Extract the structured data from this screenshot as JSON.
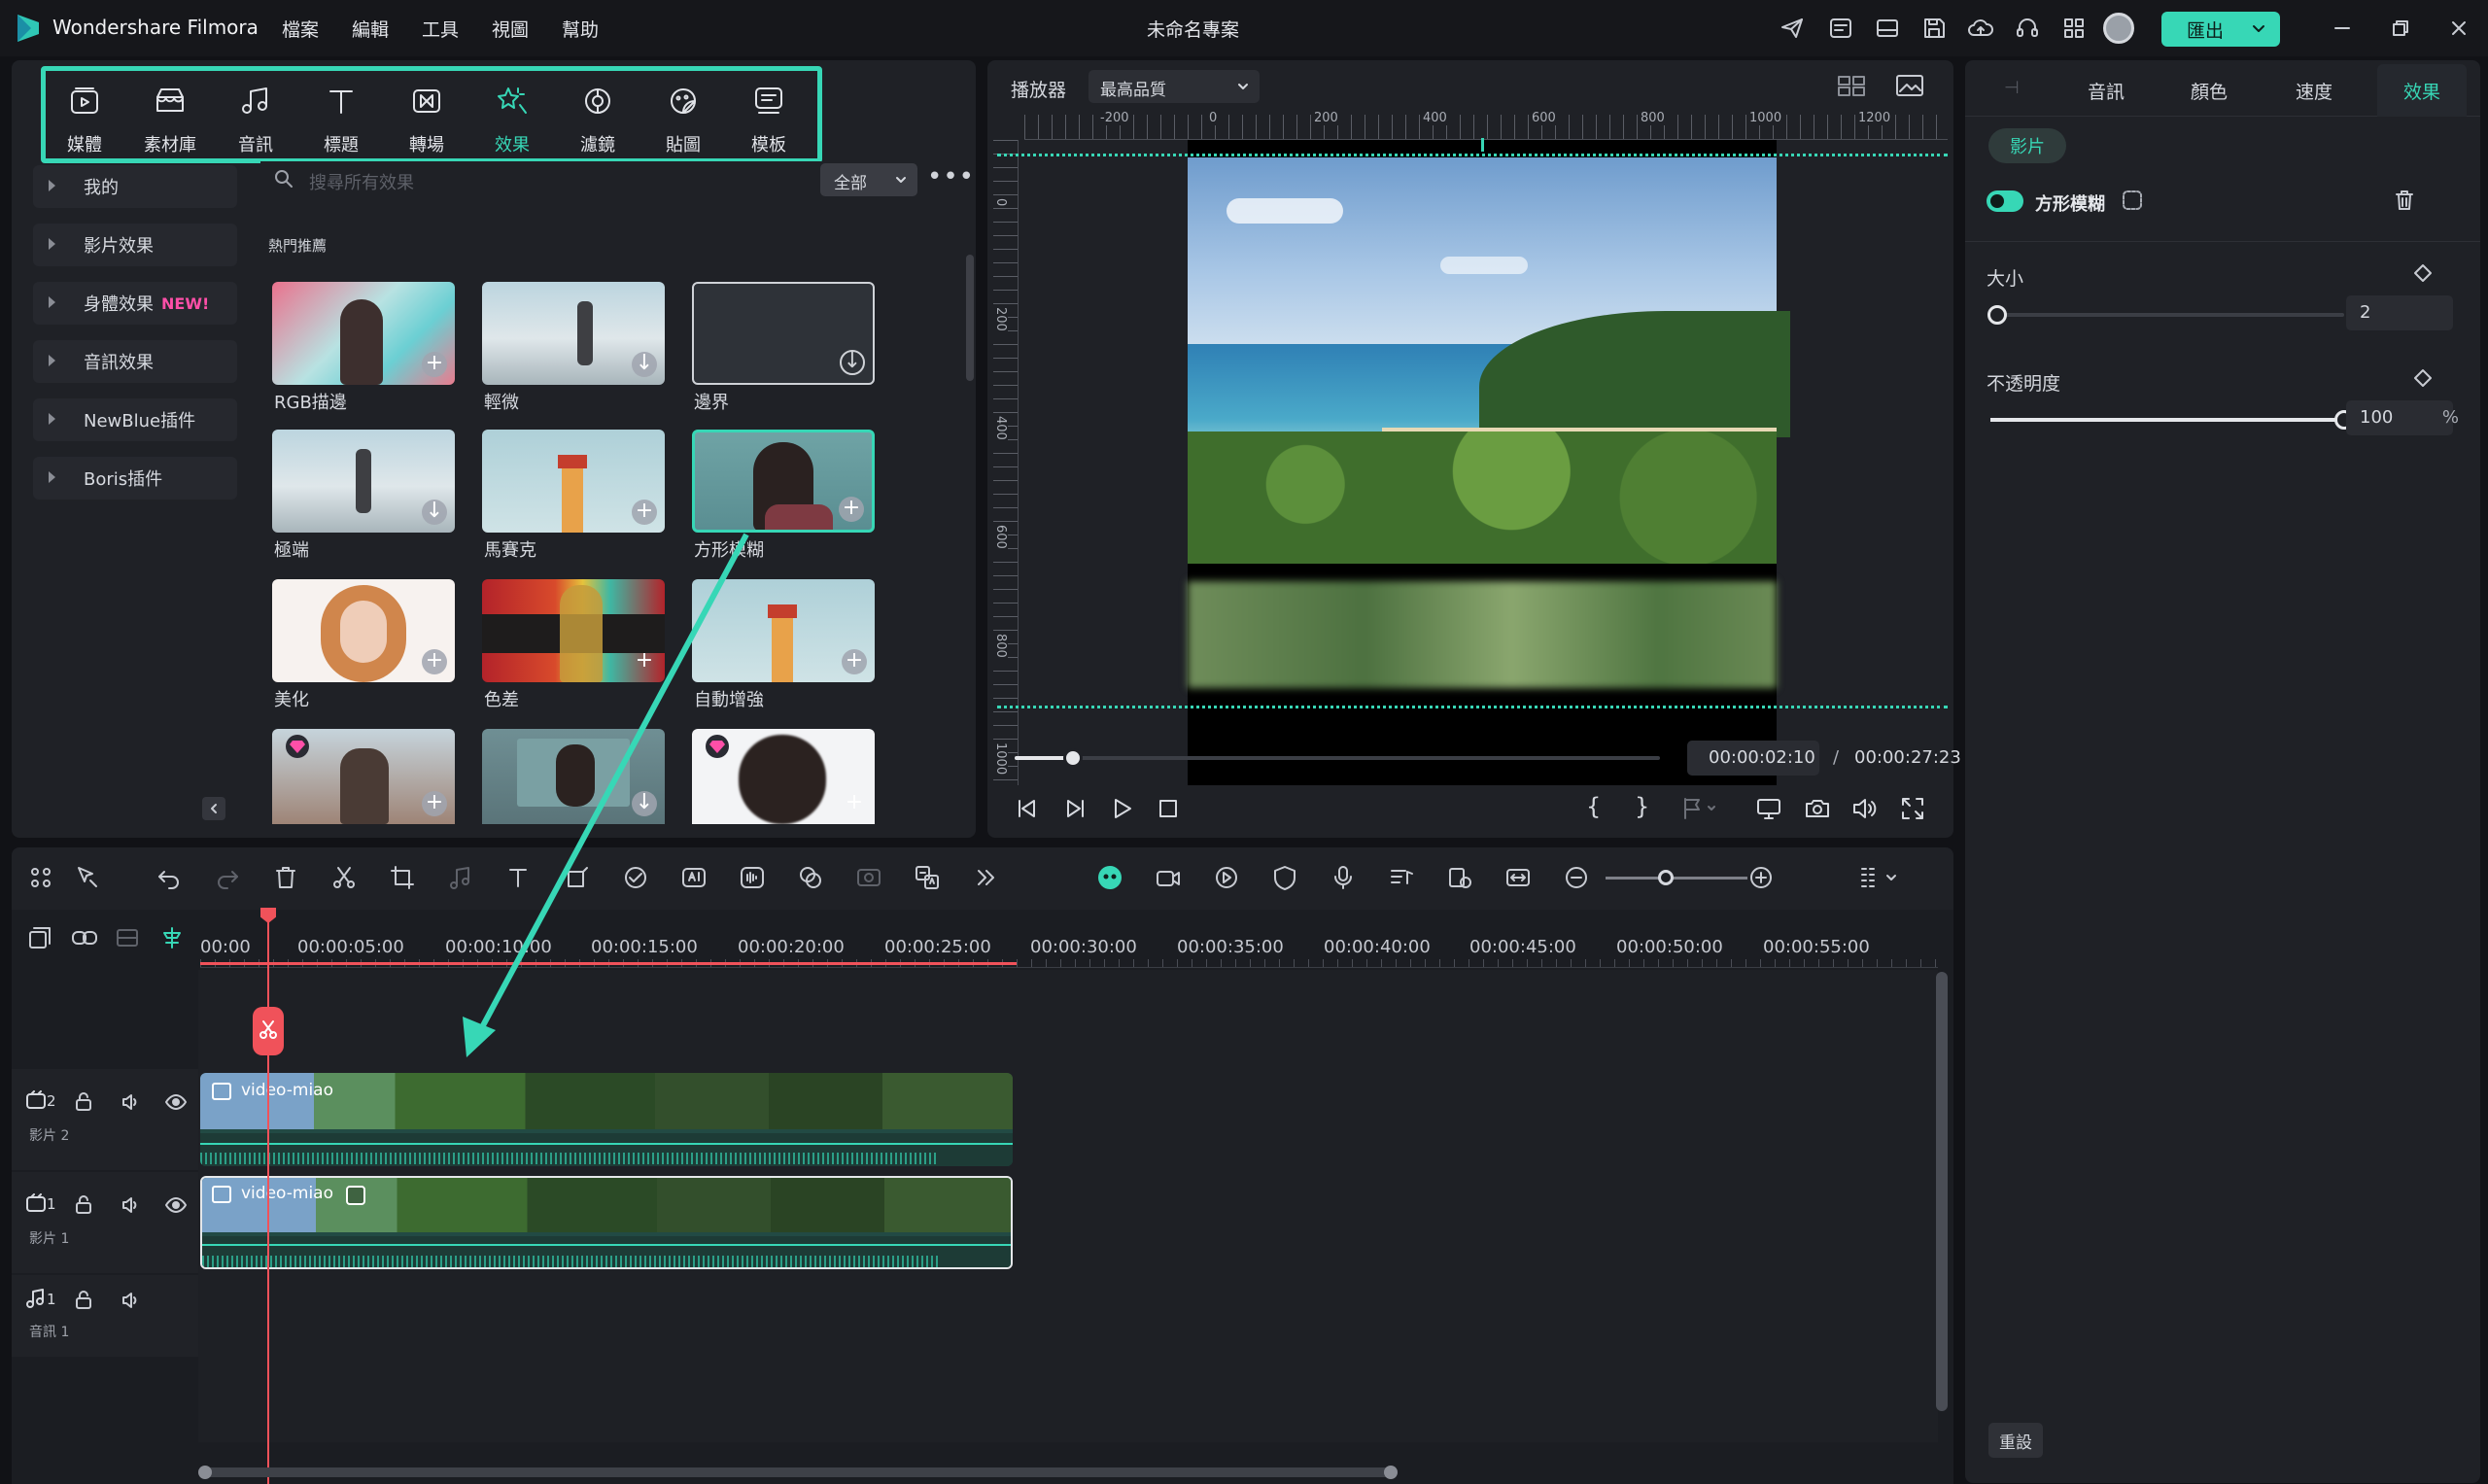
{
  "app": {
    "name": "Wondershare Filmora",
    "project_title": "未命名專案",
    "export_label": "匯出"
  },
  "menu": [
    "檔案",
    "編輯",
    "工具",
    "視圖",
    "幫助"
  ],
  "toolbar_tabs": [
    {
      "label": "媒體",
      "icon": "media-icon"
    },
    {
      "label": "素材庫",
      "icon": "stock-icon"
    },
    {
      "label": "音訊",
      "icon": "audio-icon"
    },
    {
      "label": "標題",
      "icon": "title-icon"
    },
    {
      "label": "轉場",
      "icon": "transition-icon"
    },
    {
      "label": "效果",
      "icon": "effects-icon"
    },
    {
      "label": "濾鏡",
      "icon": "filter-icon"
    },
    {
      "label": "貼圖",
      "icon": "sticker-icon"
    },
    {
      "label": "模板",
      "icon": "template-icon"
    }
  ],
  "active_tab": "效果",
  "sidebar": {
    "items": [
      {
        "label": "我的"
      },
      {
        "label": "影片效果"
      },
      {
        "label": "身體效果",
        "badge": "NEW!"
      },
      {
        "label": "音訊效果"
      },
      {
        "label": "NewBlue插件"
      },
      {
        "label": "Boris插件"
      }
    ]
  },
  "search": {
    "placeholder": "搜尋所有效果",
    "filter_value": "全部"
  },
  "section_title": "熱門推薦",
  "effects": [
    {
      "label": "RGB描邊",
      "action": "add"
    },
    {
      "label": "輕微",
      "action": "download"
    },
    {
      "label": "邊界",
      "action": "download"
    },
    {
      "label": "極端",
      "action": "download"
    },
    {
      "label": "馬賽克",
      "action": "add"
    },
    {
      "label": "方形模糊",
      "action": "add",
      "selected": true
    },
    {
      "label": "美化",
      "action": "add"
    },
    {
      "label": "色差",
      "action": "add"
    },
    {
      "label": "自動增強",
      "action": "add"
    },
    {
      "label": "",
      "action": "add",
      "premium": true
    },
    {
      "label": "",
      "action": "download"
    },
    {
      "label": "",
      "action": "add",
      "premium": true
    }
  ],
  "player": {
    "label": "播放器",
    "quality": "最高品質",
    "ruler_h": [
      "-200",
      "0",
      "200",
      "400",
      "600",
      "800",
      "1000",
      "1200"
    ],
    "ruler_v": [
      "0",
      "200",
      "400",
      "600",
      "800",
      "1000"
    ],
    "current_time": "00:00:02:10",
    "total_time": "00:00:27:23",
    "progress": 0.09
  },
  "right_panel": {
    "tabs": [
      "音訊",
      "顏色",
      "速度",
      "效果"
    ],
    "active_tab": "效果",
    "chip": "影片",
    "effect_name": "方形模糊",
    "effect_enabled": true,
    "size": {
      "label": "大小",
      "value": "2",
      "fraction": 0.02
    },
    "opacity": {
      "label": "不透明度",
      "value": "100",
      "unit": "%",
      "fraction": 1.0
    },
    "reset_label": "重設"
  },
  "timeline": {
    "ruler": [
      "00:00",
      "00:00:05:00",
      "00:00:10:00",
      "00:00:15:00",
      "00:00:20:00",
      "00:00:25:00",
      "00:00:30:00",
      "00:00:35:00",
      "00:00:40:00",
      "00:00:45:00",
      "00:00:50:00",
      "00:00:55:00"
    ],
    "tracks": [
      {
        "num": "2",
        "name": "影片 2",
        "type": "video",
        "clip": "video-miao"
      },
      {
        "num": "1",
        "name": "影片 1",
        "type": "video",
        "clip": "video-miao",
        "selected": true
      },
      {
        "num": "1",
        "name": "音訊 1",
        "type": "audio"
      }
    ]
  },
  "colors": {
    "accent": "#37d7b6",
    "playhead": "#f0525a",
    "premium": "#ff4fa8",
    "new_badge": "#ff4fa8"
  }
}
